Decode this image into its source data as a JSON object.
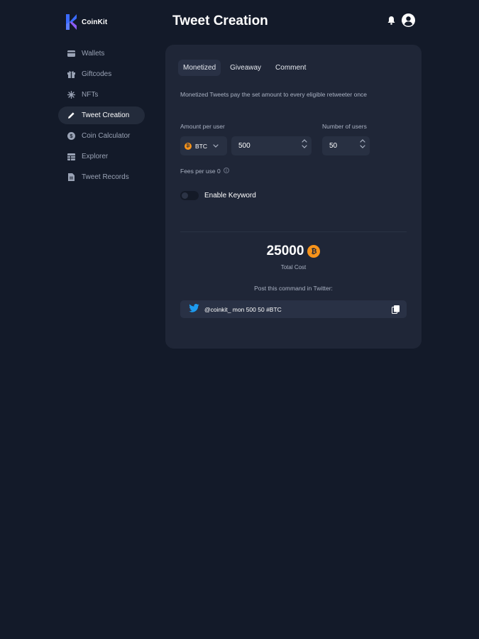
{
  "app": {
    "name": "CoinKit"
  },
  "header": {
    "title": "Tweet Creation"
  },
  "sidebar": {
    "items": [
      {
        "label": "Wallets",
        "icon": "wallet-icon",
        "active": false
      },
      {
        "label": "Giftcodes",
        "icon": "gift-icon",
        "active": false
      },
      {
        "label": "NFTs",
        "icon": "sparkle-icon",
        "active": false
      },
      {
        "label": "Tweet Creation",
        "icon": "pencil-icon",
        "active": true
      },
      {
        "label": "Coin Calculator",
        "icon": "dollar-coin-icon",
        "active": false
      },
      {
        "label": "Explorer",
        "icon": "table-icon",
        "active": false
      },
      {
        "label": "Tweet Records",
        "icon": "document-icon",
        "active": false
      }
    ]
  },
  "tabs": [
    {
      "label": "Monetized",
      "active": true
    },
    {
      "label": "Giveaway",
      "active": false
    },
    {
      "label": "Comment",
      "active": false
    }
  ],
  "form": {
    "description": "Monetized Tweets pay the set amount to every eligible retweeter once",
    "amount_label": "Amount per user",
    "users_label": "Number of users",
    "currency": "BTC",
    "currency_symbol": "₿",
    "amount_value": "500",
    "users_value": "50",
    "fees_text": "Fees per use 0",
    "keyword_label": "Enable Keyword",
    "keyword_enabled": false
  },
  "summary": {
    "total_value": "25000",
    "total_label": "Total Cost",
    "post_label": "Post this command in Twitter:",
    "command": "@coinkit_ mon 500 50 #BTC"
  },
  "colors": {
    "background": "#131a29",
    "card": "#1f2637",
    "btc": "#f7931a",
    "twitter": "#1d9bf0",
    "logo_blue": "#3b6bff",
    "logo_purple": "#8b5cf6"
  }
}
